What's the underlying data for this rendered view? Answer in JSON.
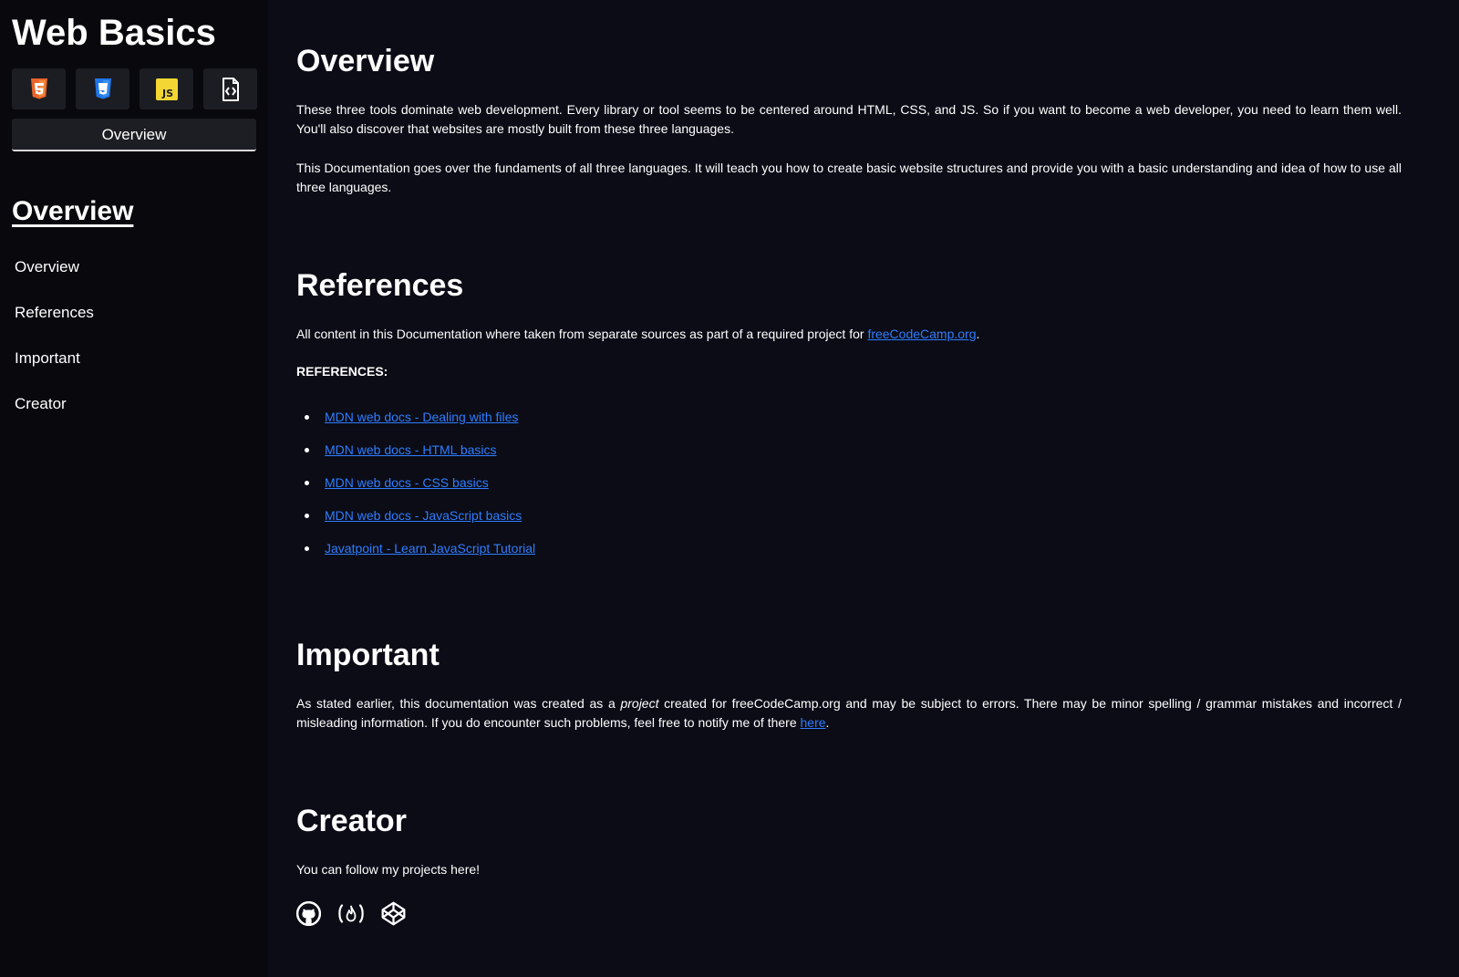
{
  "sidebar": {
    "title": "Web Basics",
    "tech_icons": [
      {
        "name": "html5-icon",
        "color": "#e8652b"
      },
      {
        "name": "css3-icon",
        "color": "#1f78e8"
      },
      {
        "name": "javascript-icon",
        "color": "#f3d634",
        "label": "JS"
      },
      {
        "name": "code-file-icon",
        "color": "#ffffff"
      }
    ],
    "overview_button": "Overview",
    "nav_heading": "Overview",
    "nav_items": [
      "Overview",
      "References",
      "Important",
      "Creator"
    ]
  },
  "main": {
    "overview": {
      "title": "Overview",
      "p1": "These three tools dominate web development. Every library or tool seems to be centered around HTML, CSS, and JS. So if you want to become a web developer, you need to learn them well. You'll also discover that websites are mostly built from these three languages.",
      "p2": "This Documentation goes over the fundaments of all three languages. It will teach you how to create basic website structures and provide you with a basic understanding and idea of how to use all three languages."
    },
    "references": {
      "title": "References",
      "text_before": "All content in this Documentation where taken from separate sources as part of a required project for ",
      "link": "freeCodeCamp.org",
      "text_after": ".",
      "label": "REFERENCES:",
      "items": [
        "MDN web docs - Dealing with files",
        "MDN web docs - HTML basics",
        "MDN web docs - CSS basics",
        "MDN web docs - JavaScript basics",
        "Javatpoint - Learn JavaScript Tutorial"
      ]
    },
    "important": {
      "title": "Important",
      "text_before": "As stated earlier, this documentation was created as a ",
      "emphasis": "project",
      "text_middle": " created for freeCodeCamp.org and may be subject to errors. There may be minor spelling / grammar mistakes and incorrect / misleading information. If you do encounter such problems, feel free to notify me of there ",
      "link": "here",
      "text_after": "."
    },
    "creator": {
      "title": "Creator",
      "text": "You can follow my projects here!",
      "social_icons": [
        "github-icon",
        "freecodecamp-icon",
        "codepen-icon"
      ]
    }
  },
  "colors": {
    "background": "#0b0c16",
    "sidebar": "#08080d",
    "link": "#2f7dff"
  }
}
